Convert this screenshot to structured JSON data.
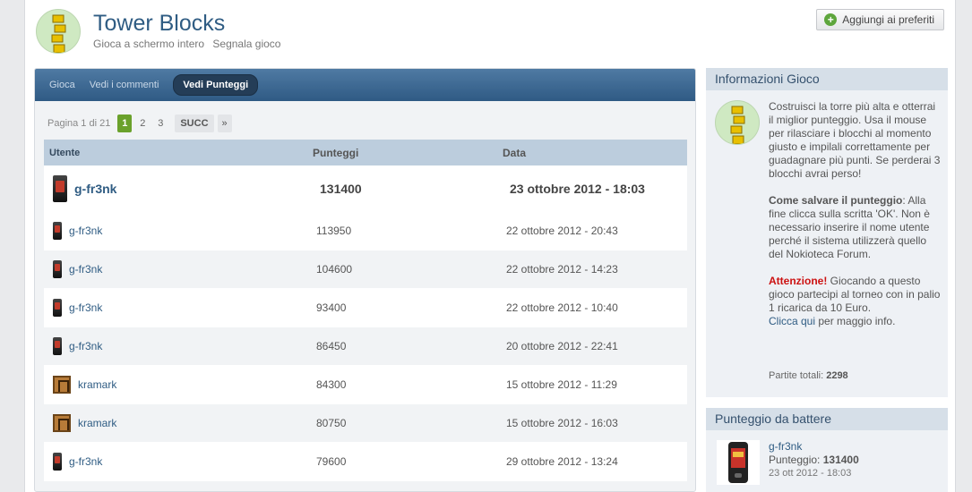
{
  "header": {
    "title": "Tower Blocks",
    "links": [
      "Gioca a schermo intero",
      "Segnala gioco"
    ],
    "fav_button": "Aggiungi ai preferiti"
  },
  "tabs": [
    {
      "label": "Gioca",
      "active": false
    },
    {
      "label": "Vedi i commenti",
      "active": false
    },
    {
      "label": "Vedi Punteggi",
      "active": true
    }
  ],
  "pager": {
    "label": "Pagina 1 di 21",
    "pages": [
      "1",
      "2",
      "3"
    ],
    "current": "1",
    "next": "SUCC",
    "last": "»"
  },
  "table": {
    "headers": {
      "user": "Utente",
      "score": "Punteggi",
      "date": "Data"
    },
    "rows": [
      {
        "user": "g-fr3nk",
        "avatar": "phone-icon",
        "score": "131400",
        "date": "23 ottobre 2012 - 18:03"
      },
      {
        "user": "g-fr3nk",
        "avatar": "phone-icon",
        "score": "113950",
        "date": "22 ottobre 2012 - 20:43"
      },
      {
        "user": "g-fr3nk",
        "avatar": "phone-icon",
        "score": "104600",
        "date": "22 ottobre 2012 - 14:23"
      },
      {
        "user": "g-fr3nk",
        "avatar": "phone-icon",
        "score": "93400",
        "date": "22 ottobre 2012 - 10:40"
      },
      {
        "user": "g-fr3nk",
        "avatar": "phone-icon",
        "score": "86450",
        "date": "20 ottobre 2012 - 22:41"
      },
      {
        "user": "kramark",
        "avatar": "gate-icon",
        "score": "84300",
        "date": "15 ottobre 2012 - 11:29"
      },
      {
        "user": "kramark",
        "avatar": "gate-icon",
        "score": "80750",
        "date": "15 ottobre 2012 - 16:03"
      },
      {
        "user": "g-fr3nk",
        "avatar": "phone-icon",
        "score": "79600",
        "date": "29 ottobre 2012 - 13:24"
      }
    ]
  },
  "info": {
    "title": "Informazioni Gioco",
    "description": "Costruisci la torre più alta e otterrai il miglior punteggio. Usa il mouse per rilasciare i blocchi al momento giusto e impilali correttamente per guadagnare più punti. Se perderai 3 blocchi avrai perso!",
    "save_title": "Come salvare il punteggio",
    "save_text": ": Alla fine clicca sulla scritta 'OK'. Non è necessario inserire il nome utente perché il sistema utilizzerà quello del Nokioteca Forum.",
    "warn_title": "Attenzione!",
    "warn_text": " Giocando a questo gioco partecipi al torneo con in palio 1 ricarica da 10 Euro.",
    "more_link": "Clicca qui",
    "more_text": " per maggio info.",
    "total_label": "Partite totali: ",
    "total_value": "2298"
  },
  "beat": {
    "title": "Punteggio da battere",
    "user": "g-fr3nk",
    "score_label": "Punteggio: ",
    "score_value": "131400",
    "date": "23 ott 2012 - 18:03"
  },
  "colors": {
    "accent": "#2f5c83",
    "tab_bar": "#3c668f",
    "active_page": "#6aa12b",
    "warn": "#cc1111"
  }
}
